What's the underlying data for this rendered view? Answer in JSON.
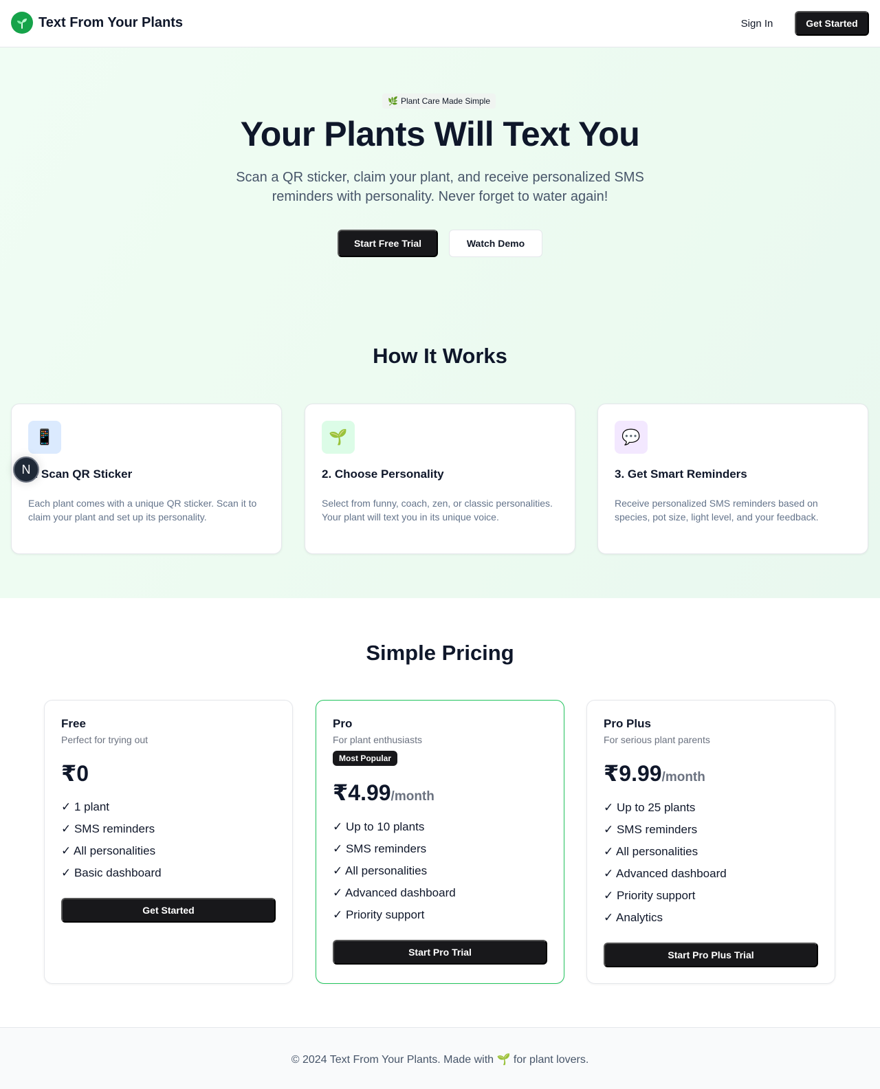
{
  "header": {
    "brand_name": "Text From Your Plants",
    "logo_icon": "seedling-icon",
    "sign_in_label": "Sign In",
    "get_started_label": "Get Started"
  },
  "hero": {
    "badge_icon": "🌿",
    "badge_text": "Plant Care Made Simple",
    "title": "Your Plants Will Text You",
    "subtitle": "Scan a QR sticker, claim your plant, and receive personalized SMS reminders with personality. Never forget to water again!",
    "primary_cta": "Start Free Trial",
    "secondary_cta": "Watch Demo"
  },
  "how_it_works": {
    "title": "How It Works",
    "steps": [
      {
        "icon": "📱",
        "icon_name": "phone-icon",
        "icon_bg": "#dbeafe",
        "title": "1. Scan QR Sticker",
        "description": "Each plant comes with a unique QR sticker. Scan it to claim your plant and set up its personality."
      },
      {
        "icon": "🌱",
        "icon_name": "seedling-icon",
        "icon_bg": "#dcfce7",
        "title": "2. Choose Personality",
        "description": "Select from funny, coach, zen, or classic personalities. Your plant will text you in its unique voice."
      },
      {
        "icon": "💬",
        "icon_name": "speech-bubble-icon",
        "icon_bg": "#f3e8ff",
        "title": "3. Get Smart Reminders",
        "description": "Receive personalized SMS reminders based on species, pot size, light level, and your feedback."
      }
    ]
  },
  "floating_badge": {
    "letter": "N"
  },
  "pricing": {
    "title": "Simple Pricing",
    "plans": [
      {
        "name": "Free",
        "tagline": "Perfect for trying out",
        "price": "₹0",
        "period": "",
        "badge": "",
        "features": [
          "✓ 1 plant",
          "✓ SMS reminders",
          "✓ All personalities",
          "✓ Basic dashboard"
        ],
        "cta": "Get Started"
      },
      {
        "name": "Pro",
        "tagline": "For plant enthusiasts",
        "price": "₹4.99",
        "period": "/month",
        "badge": "Most Popular",
        "features": [
          "✓ Up to 10 plants",
          "✓ SMS reminders",
          "✓ All personalities",
          "✓ Advanced dashboard",
          "✓ Priority support"
        ],
        "cta": "Start Pro Trial"
      },
      {
        "name": "Pro Plus",
        "tagline": "For serious plant parents",
        "price": "₹9.99",
        "period": "/month",
        "badge": "",
        "features": [
          "✓ Up to 25 plants",
          "✓ SMS reminders",
          "✓ All personalities",
          "✓ Advanced dashboard",
          "✓ Priority support",
          "✓ Analytics"
        ],
        "cta": "Start Pro Plus Trial"
      }
    ]
  },
  "footer": {
    "text_before": "© 2024 Text From Your Plants. Made with",
    "icon": "🌱",
    "text_after": "for plant lovers."
  },
  "colors": {
    "accent": "#16a34a",
    "primary_button": "#18181b",
    "featured_border": "#22c55e",
    "hero_bg": "#f0fdf4"
  }
}
